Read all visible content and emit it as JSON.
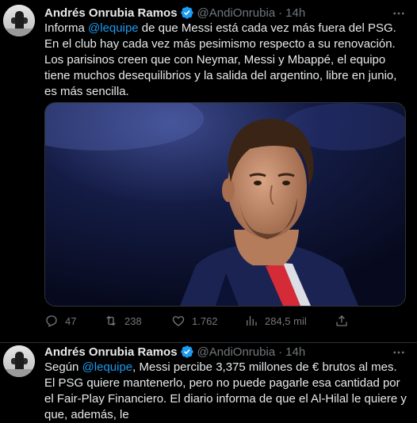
{
  "tweets": [
    {
      "author_name": "Andrés Onrubia Ramos",
      "handle": "@AndiOnrubia",
      "separator": "·",
      "time": "14h",
      "text_parts": [
        "Informa ",
        "@lequipe",
        " de que Messi está cada vez más fuera del PSG. En el club hay cada vez más pesimismo respecto a su renovación. Los parisinos creen que con Neymar, Messi y Mbappé, el equipo tiene muchos desequilibrios y la salida del argentino, libre en junio, es más sencilla."
      ],
      "media_icon": "photo-lionel-messi-psg",
      "metrics": {
        "replies": "47",
        "retweets": "238",
        "likes": "1.762",
        "views": "284,5 mil"
      }
    },
    {
      "author_name": "Andrés Onrubia Ramos",
      "handle": "@AndiOnrubia",
      "separator": "·",
      "time": "14h",
      "text_parts": [
        "Según ",
        "@lequipe",
        ", Messi percibe 3,375 millones de € brutos al mes. El PSG quiere mantenerlo, pero no puede pagarle esa cantidad por el Fair-Play Financiero. El diario informa de que el Al-Hilal le quiere y que, además, le"
      ]
    }
  ],
  "colors": {
    "background": "#000000",
    "text": "#e7e9ea",
    "secondary": "#71767b",
    "accent": "#1d9bf0",
    "divider": "#2f3336"
  },
  "icons": [
    "more-icon",
    "verified-badge-icon",
    "reply-icon",
    "retweet-icon",
    "like-icon",
    "views-icon",
    "share-icon"
  ]
}
